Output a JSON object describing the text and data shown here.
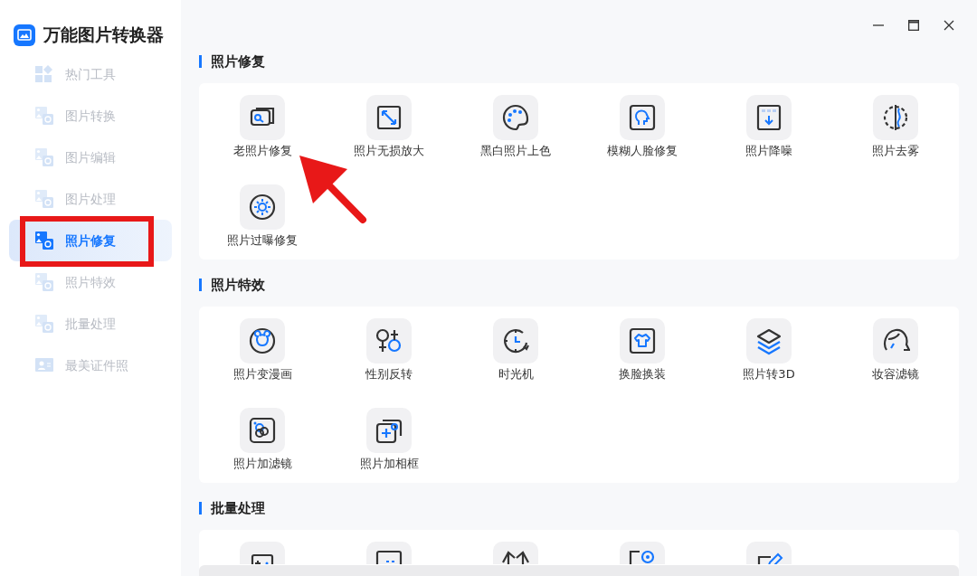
{
  "app": {
    "title": "万能图片转换器"
  },
  "sidebar": {
    "items": [
      {
        "label": "热门工具",
        "selected": false,
        "highlighted": false
      },
      {
        "label": "图片转换",
        "selected": false,
        "highlighted": false
      },
      {
        "label": "图片编辑",
        "selected": false,
        "highlighted": false
      },
      {
        "label": "图片处理",
        "selected": false,
        "highlighted": false
      },
      {
        "label": "照片修复",
        "selected": true,
        "highlighted": true
      },
      {
        "label": "照片特效",
        "selected": false,
        "highlighted": false
      },
      {
        "label": "批量处理",
        "selected": false,
        "highlighted": false
      },
      {
        "label": "最美证件照",
        "selected": false,
        "highlighted": false
      }
    ]
  },
  "sections": [
    {
      "title": "照片修复",
      "tiles": [
        {
          "kind": "full",
          "label": "老照片修复",
          "pointed": true
        },
        {
          "kind": "full",
          "label": "照片无损放大",
          "pointed": false
        },
        {
          "kind": "full",
          "label": "黑白照片上色",
          "pointed": false
        },
        {
          "kind": "full",
          "label": "模糊人脸修复",
          "pointed": false
        },
        {
          "kind": "full",
          "label": "照片降噪",
          "pointed": false
        },
        {
          "kind": "full",
          "label": "照片去雾",
          "pointed": false
        },
        {
          "kind": "full",
          "label": "照片过曝修复",
          "pointed": false
        }
      ]
    },
    {
      "title": "照片特效",
      "tiles": [
        {
          "kind": "full",
          "label": "照片变漫画",
          "pointed": false
        },
        {
          "kind": "full",
          "label": "性别反转",
          "pointed": false
        },
        {
          "kind": "full",
          "label": "时光机",
          "pointed": false
        },
        {
          "kind": "full",
          "label": "换脸换装",
          "pointed": false
        },
        {
          "kind": "full",
          "label": "照片转3D",
          "pointed": false
        },
        {
          "kind": "full",
          "label": "妆容滤镜",
          "pointed": false
        },
        {
          "kind": "full",
          "label": "照片加滤镜",
          "pointed": false
        },
        {
          "kind": "full",
          "label": "照片加相框",
          "pointed": false
        }
      ]
    },
    {
      "title": "批量处理",
      "tiles": [
        {
          "kind": "cut"
        },
        {
          "kind": "cut"
        },
        {
          "kind": "cut"
        },
        {
          "kind": "cut"
        },
        {
          "kind": "cut"
        }
      ]
    }
  ]
}
